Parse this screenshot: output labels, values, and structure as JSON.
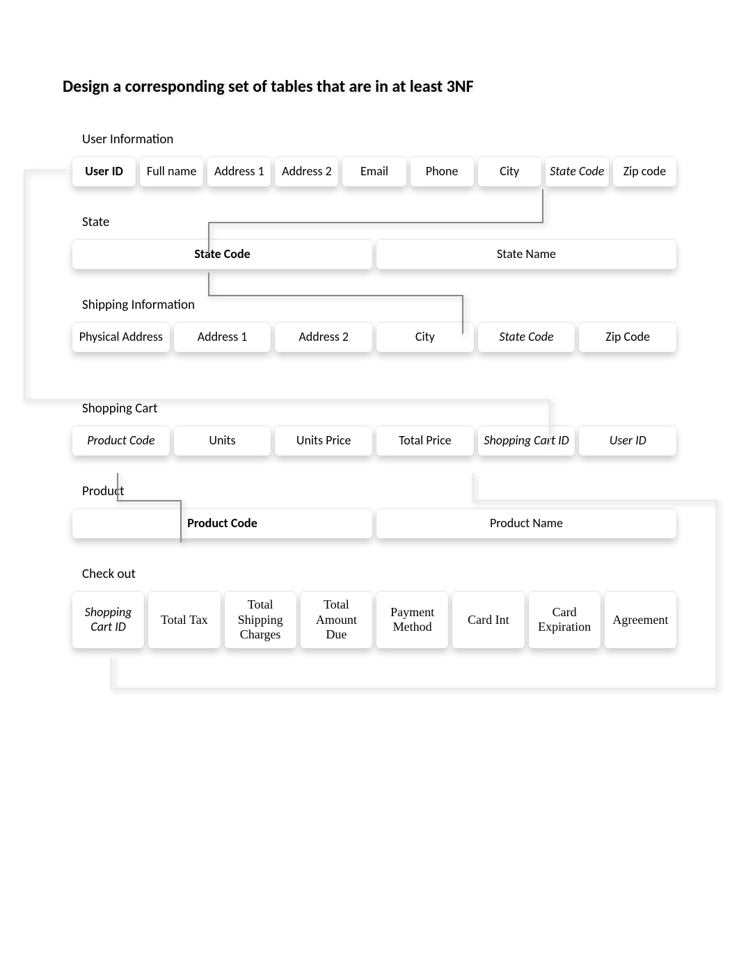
{
  "title": "Design a corresponding set of tables that are in at least 3NF",
  "tables": {
    "user": {
      "label": "User Information",
      "cols": [
        "User ID",
        "Full name",
        "Address 1",
        "Address 2",
        "Email",
        "Phone",
        "City",
        "State Code",
        "Zip code"
      ]
    },
    "state": {
      "label": "State",
      "cols": [
        "State Code",
        "State Name"
      ]
    },
    "shipping": {
      "label": "Shipping Information",
      "cols": [
        "Physical Address",
        "Address 1",
        "Address 2",
        "City",
        "State Code",
        "Zip Code"
      ]
    },
    "cart": {
      "label": "Shopping Cart",
      "cols": [
        "Product Code",
        "Units",
        "Units Price",
        "Total Price",
        "Shopping Cart ID",
        "User ID"
      ]
    },
    "product": {
      "label": "Product",
      "cols": [
        "Product Code",
        "Product Name"
      ]
    },
    "checkout": {
      "label": "Check out",
      "cols": [
        "Shopping Cart ID",
        "Total Tax",
        "Total Shipping Charges",
        "Total Amount Due",
        "Payment Method",
        "Card Int",
        "Card Expiration",
        "Agreement"
      ]
    }
  }
}
